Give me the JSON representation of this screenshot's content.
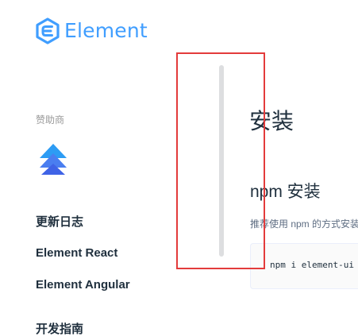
{
  "logo": {
    "text": "Element",
    "icon": "element-hexagon-logo-icon",
    "brand_color": "#409eff"
  },
  "sidebar": {
    "sponsor_title": "赞助商",
    "sponsor_logo_icon": "blue-chevron-up-sponsor-logo",
    "items": [
      {
        "label": "更新日志"
      },
      {
        "label": "Element React"
      },
      {
        "label": "Element Angular"
      },
      {
        "label": "开发指南"
      }
    ]
  },
  "main": {
    "title": "安装",
    "npm_heading": "npm 安装",
    "recommend_text": "推荐使用 npm 的方式安装",
    "code": "npm i element-ui -S"
  },
  "annotation": {
    "highlight_color": "#e33b3b"
  }
}
